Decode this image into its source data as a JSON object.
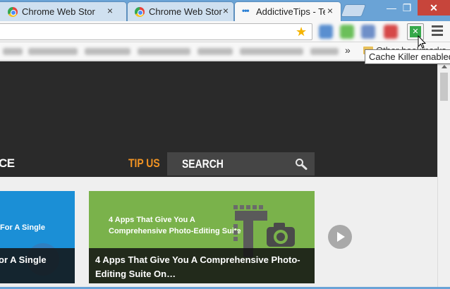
{
  "tabs": [
    {
      "title": "Chrome Web Store",
      "close": "×"
    },
    {
      "title": "Chrome Web Store",
      "close": "×"
    },
    {
      "title": "AddictiveTips - Te",
      "close": "×",
      "active": true,
      "favicon": "•••"
    }
  ],
  "window_controls": {
    "minimize": "—",
    "maximize": "❐",
    "close": "✕"
  },
  "toolbar": {
    "star": "★",
    "extension_badge": "✕"
  },
  "bookmarks": {
    "overflow": "»",
    "other": "Other bookmarks"
  },
  "tooltip": "Cache Killer enabled",
  "site": {
    "nav_partial": "CE",
    "tip_us": "TIP US",
    "search_label": "SEARCH",
    "accent_color": "#f29423"
  },
  "cards": [
    {
      "kicker": "For A Single",
      "caption": "or A Single"
    },
    {
      "kicker": "4 Apps That Give You A Comprehensive Photo-Editing Suite",
      "caption": "4 Apps That Give You A Comprehensive Photo-Editing Suite On…"
    }
  ],
  "icons": [
    "chrome-store-icon",
    "addictivetips-icon",
    "star-icon",
    "cache-killer-icon",
    "menu-icon",
    "folder-icon",
    "search-icon",
    "play-icon"
  ]
}
